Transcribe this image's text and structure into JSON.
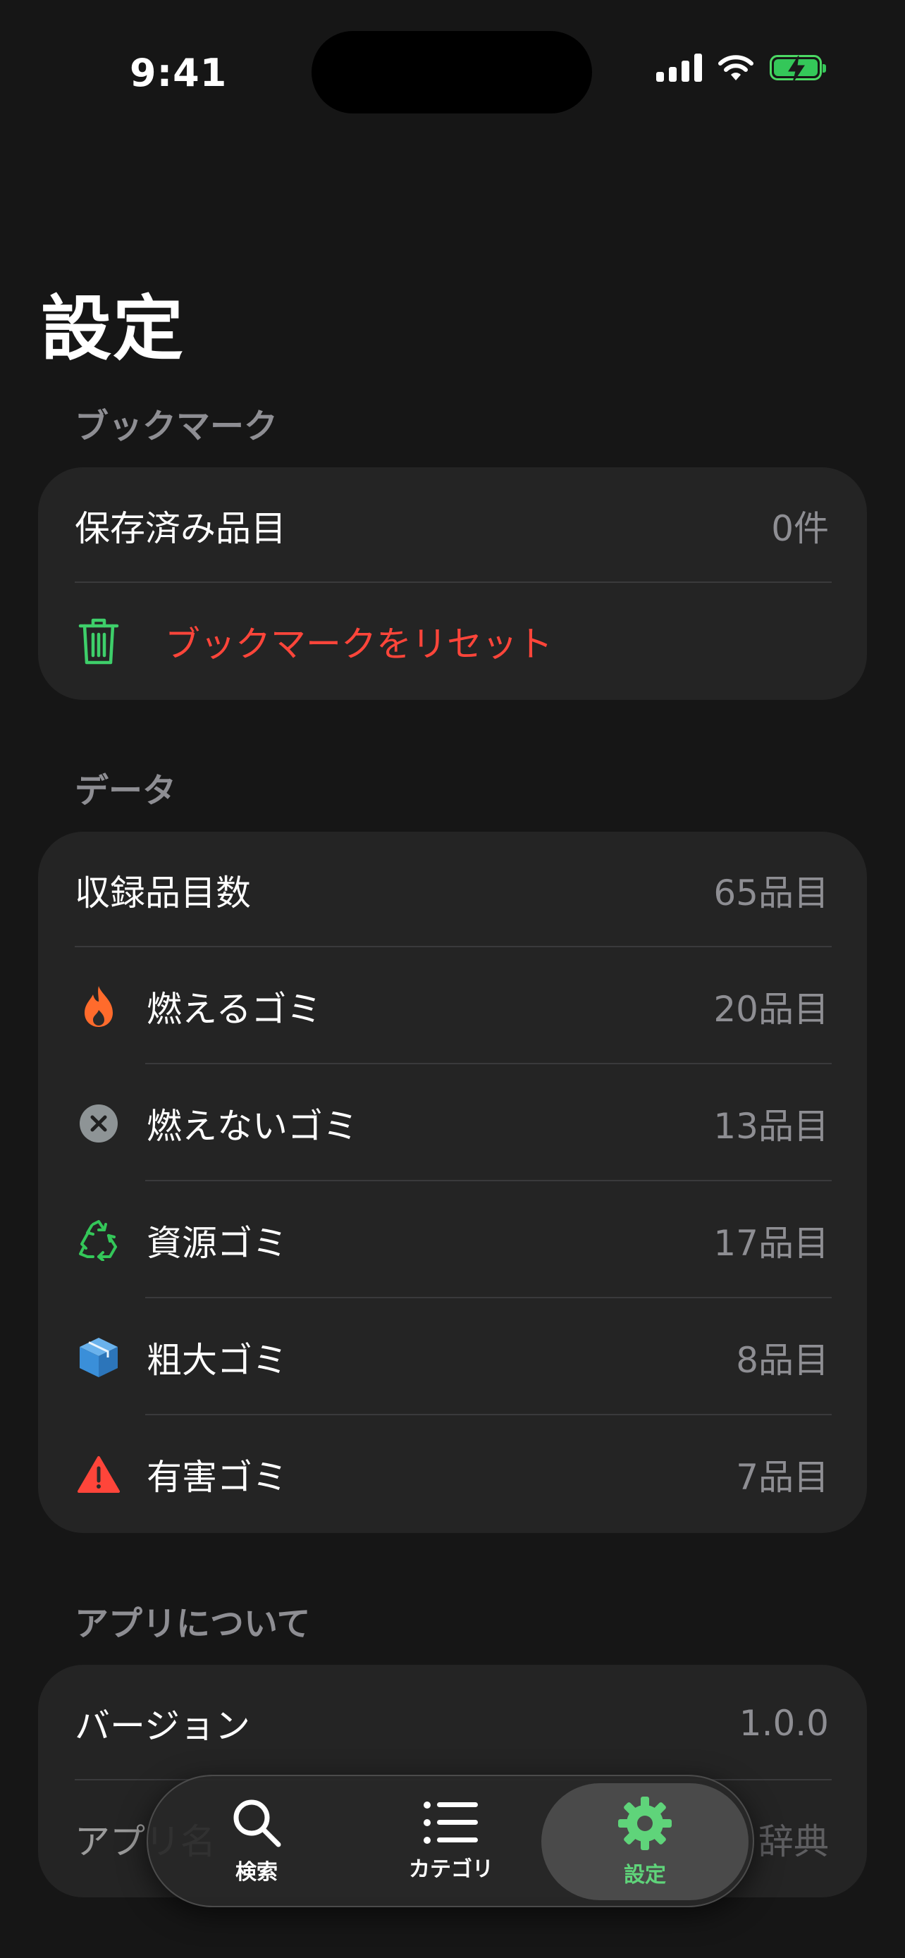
{
  "status_bar": {
    "time": "9:41"
  },
  "page_title": "設定",
  "bookmark_section": {
    "header": "ブックマーク",
    "saved_label": "保存済み品目",
    "saved_value": "0件",
    "reset_label": "ブックマークをリセット"
  },
  "data_section": {
    "header": "データ",
    "total_label": "収録品目数",
    "total_value": "65品目",
    "categories": [
      {
        "label": "燃えるゴミ",
        "value": "20品目",
        "icon": "flame-icon",
        "color": "#ff6b2c"
      },
      {
        "label": "燃えないゴミ",
        "value": "13品目",
        "icon": "x-circle-icon",
        "color": "#8e9496"
      },
      {
        "label": "資源ゴミ",
        "value": "17品目",
        "icon": "recycle-icon",
        "color": "#34c759"
      },
      {
        "label": "粗大ゴミ",
        "value": "8品目",
        "icon": "box-icon",
        "color": "#3a8fd9"
      },
      {
        "label": "有害ゴミ",
        "value": "7品目",
        "icon": "warning-icon",
        "color": "#ff453a"
      }
    ]
  },
  "about_section": {
    "header": "アプリについて",
    "version_label": "バージョン",
    "version_value": "1.0.0",
    "app_name_label": "アプリ名",
    "app_name_value": "辞典"
  },
  "tab_bar": {
    "tabs": [
      {
        "label": "検索",
        "icon": "search-icon"
      },
      {
        "label": "カテゴリ",
        "icon": "list-icon"
      },
      {
        "label": "設定",
        "icon": "gear-icon"
      }
    ],
    "active_color": "#5fd47a"
  },
  "colors": {
    "accent_green": "#34c759",
    "destructive_red": "#ff453a",
    "card_bg": "#242424",
    "page_bg": "#161616"
  }
}
